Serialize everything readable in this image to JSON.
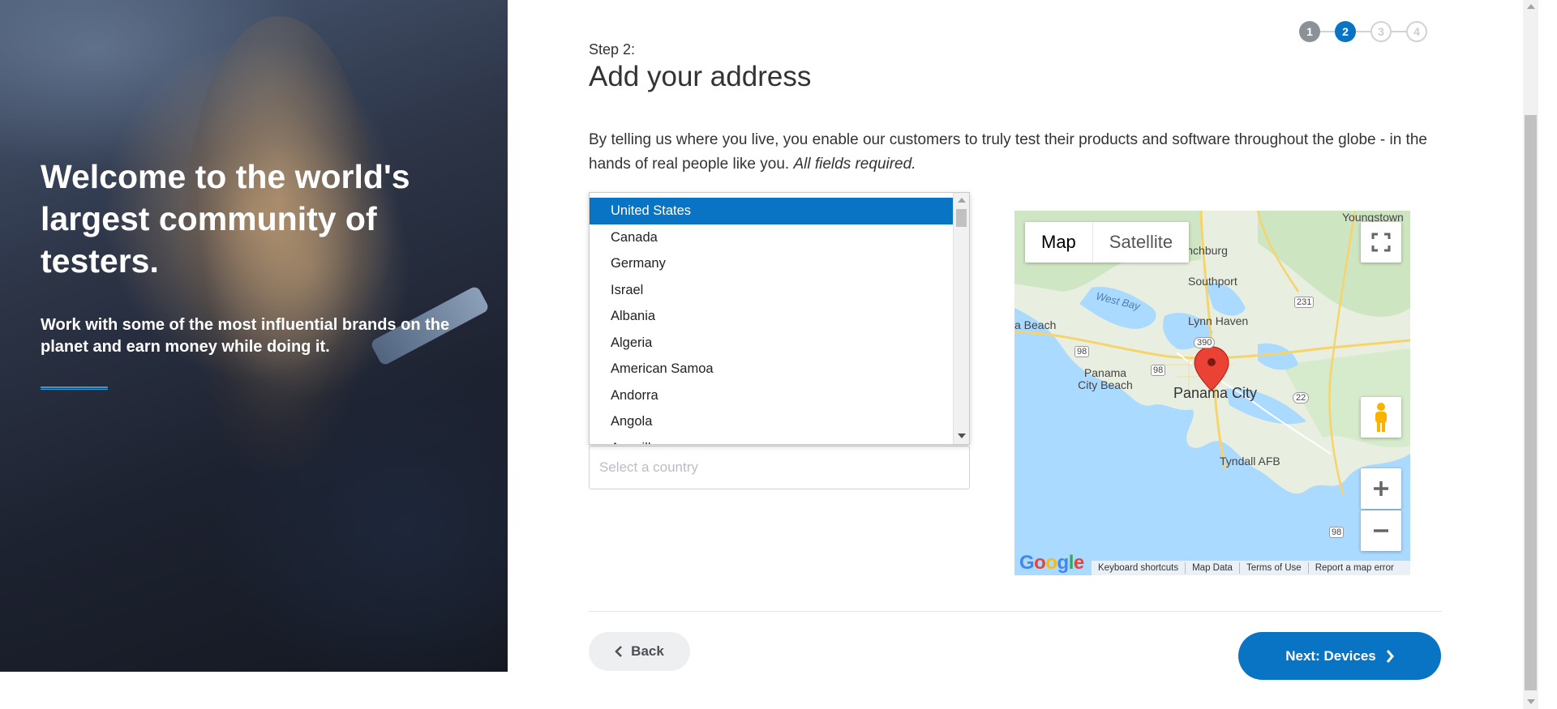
{
  "hero": {
    "title": "Welcome to the world's largest community of testers.",
    "subtitle": "Work with some of the most influential brands on the planet and earn money while doing it.",
    "accent_color": "#2aa0d8"
  },
  "stepper": {
    "steps": [
      "1",
      "2",
      "3",
      "4"
    ],
    "current": 2,
    "active_color": "#0a74c4"
  },
  "header": {
    "step_label": "Step 2:",
    "title": "Add your address"
  },
  "intro": {
    "text": "By telling us where you live, you enable our customers to truly test their products and software throughout the globe - in the hands of real people like you.",
    "emphasis": "All fields required."
  },
  "country_dropdown": {
    "selected": "United States",
    "options": [
      "United States",
      "Canada",
      "Germany",
      "Israel",
      "Albania",
      "Algeria",
      "American Samoa",
      "Andorra",
      "Angola",
      "Anguilla"
    ]
  },
  "country_field": {
    "placeholder": "Select a country"
  },
  "map": {
    "type_buttons": [
      "Map",
      "Satellite"
    ],
    "active_type": "Map",
    "labels": {
      "youngstown": "Youngstown",
      "lynchburg": "Lynchburg",
      "southport": "Southport",
      "west_bay": "West Bay",
      "lynn_haven": "Lynn Haven",
      "beach": "a Beach",
      "panama_city_beach": "Panama City Beach",
      "panama_city": "Panama City",
      "tyndall": "Tyndall AFB",
      "route_231": "231",
      "route_98a": "98",
      "route_98b": "98",
      "route_390": "390",
      "route_22": "22",
      "route_98c": "98"
    },
    "footer": [
      "Keyboard shortcuts",
      "Map Data",
      "Terms of Use",
      "Report a map error"
    ],
    "logo": "Google"
  },
  "actions": {
    "back_label": "Back",
    "next_label": "Next: Devices"
  }
}
